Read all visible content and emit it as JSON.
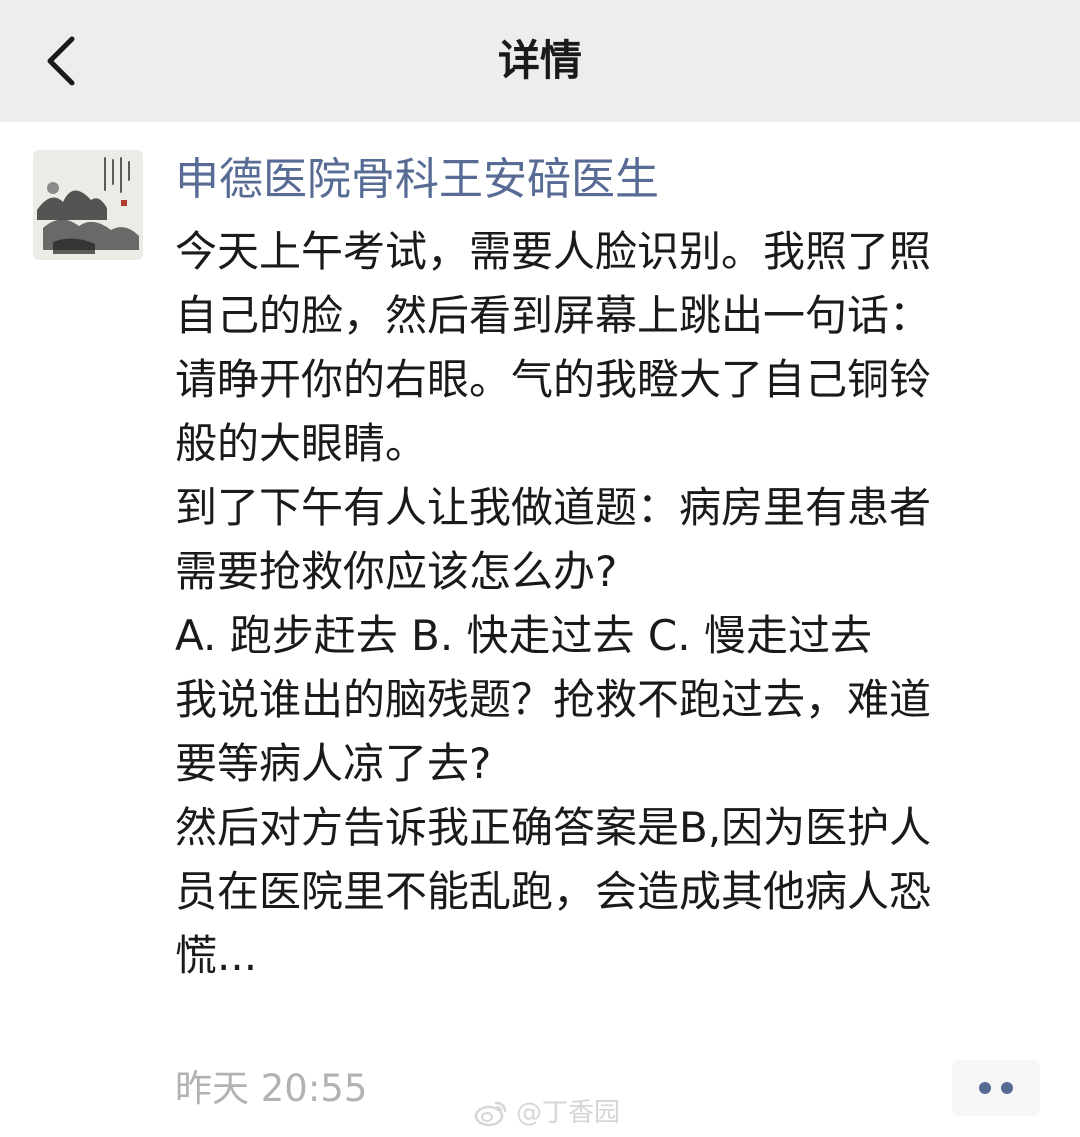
{
  "nav": {
    "title": "详情",
    "back_icon": "chevron-left-icon"
  },
  "post": {
    "author": "申德医院骨科王安碚医生",
    "lines": [
      "今天上午考试，需要人脸识别。我照了照",
      "自己的脸，然后看到屏幕上跳出一句话：",
      "请睁开你的右眼。气的我瞪大了自己铜铃",
      "般的大眼睛。",
      "到了下午有人让我做道题：病房里有患者",
      "需要抢救你应该怎么办?",
      "A. 跑步赶去  B. 快走过去  C. 慢走过去",
      "我说谁出的脑残题？抢救不跑过去，难道",
      "要等病人凉了去?",
      "然后对方告诉我正确答案是B,因为医护人",
      "员在医院里不能乱跑，会造成其他病人恐",
      "慌..."
    ],
    "timestamp": "昨天 20:55"
  },
  "watermark": {
    "text": "@丁香园",
    "icon": "weibo-icon"
  },
  "colors": {
    "nav_bg": "#ededed",
    "author": "#576b95",
    "body_text": "#1a1a1a",
    "timestamp": "#b2b2b2"
  }
}
